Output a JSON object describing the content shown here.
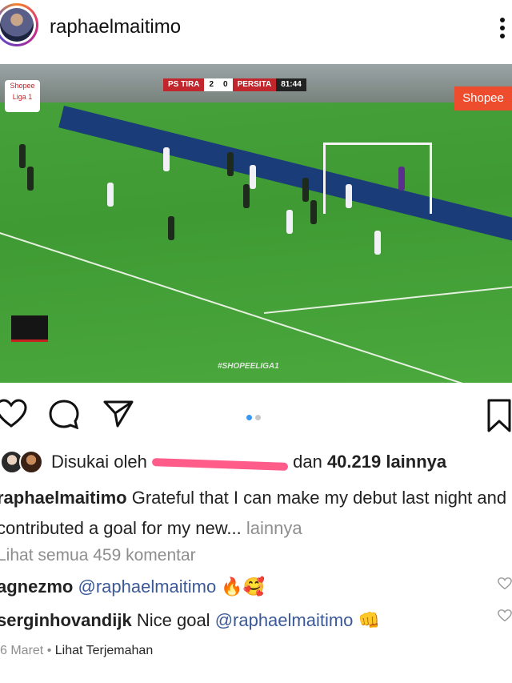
{
  "header": {
    "username": "raphaelmaitimo",
    "more_icon": "more-vertical-icon"
  },
  "media": {
    "scoreboard": {
      "home": "PS TIRA",
      "home_score": "2",
      "away_score": "0",
      "away": "PERSITA",
      "time": "81:44"
    },
    "sponsor": "Shopee",
    "liga_badge": "Shopee Liga 1",
    "hashtag": "#SHOPEELIGA1",
    "dots": {
      "count": 2,
      "active": 0,
      "active_color": "#3897f0",
      "inactive_color": "#c7c7c7"
    }
  },
  "actions": {
    "like_icon": "heart-icon",
    "comment_icon": "comment-icon",
    "share_icon": "send-icon",
    "save_icon": "bookmark-icon"
  },
  "likes": {
    "prefix": "Disukai oleh",
    "joiner": "dan",
    "count": "40.219 lainnya"
  },
  "caption": {
    "username": "raphaelmaitimo",
    "text": "Grateful that I can make my debut last night and contributed a goal for my new...",
    "more": "lainnya"
  },
  "view_comments": "Lihat semua 459 komentar",
  "comments": [
    {
      "username": "agnezmo",
      "mention": "@raphaelmaitimo",
      "text": "",
      "emoji": "🔥🥰"
    },
    {
      "username": "serginhovandijk",
      "mention": "@raphaelmaitimo",
      "text": "Nice goal",
      "emoji": "👊"
    }
  ],
  "footer": {
    "date": "6 Maret",
    "separator": "•",
    "translate": "Lihat Terjemahan"
  }
}
